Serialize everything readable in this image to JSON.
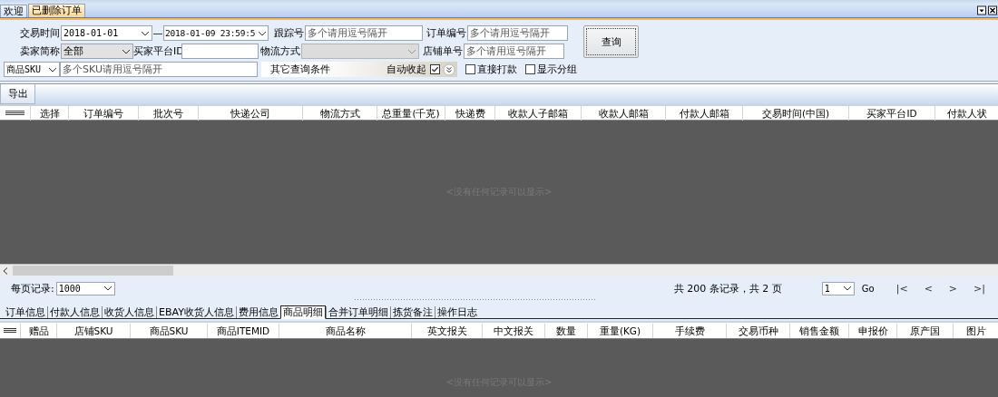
{
  "tabs": [
    {
      "label": "欢迎",
      "selected": false
    },
    {
      "label": "已删除订单",
      "selected": true
    }
  ],
  "filter": {
    "trade_time": {
      "label": "交易时间",
      "from": "2018-01-01",
      "separator": "—",
      "to": "2018-01-09 23:59:5"
    },
    "tracking_no": {
      "label": "跟踪号",
      "placeholder": "多个请用逗号隔开"
    },
    "order_no": {
      "label": "订单编号",
      "placeholder": "多个请用逗号隔开"
    },
    "seller": {
      "label": "卖家简称",
      "value": "全部"
    },
    "buyer_id": {
      "label": "买家平台ID"
    },
    "shipping_method": {
      "label": "物流方式",
      "disabled": true
    },
    "store_order_no": {
      "label": "店铺单号",
      "placeholder": "多个请用逗号隔开"
    },
    "sku": {
      "field": "商品SKU",
      "placeholder": "多个SKU请用逗号隔开"
    },
    "more": {
      "label": "其它查询条件",
      "auto_collapse": "自动收起",
      "checked": true
    },
    "options": [
      {
        "label": "直接打款",
        "checked": false
      },
      {
        "label": "显示分组",
        "checked": false
      }
    ],
    "query_button": "查询"
  },
  "toolbar": {
    "export_button": "导出"
  },
  "orders_grid": {
    "columns": [
      "选择",
      "订单编号",
      "批次号",
      "快递公司",
      "物流方式",
      "总重量(千克)",
      "快递费",
      "收款人子邮箱",
      "收款人邮箱",
      "付款人邮箱",
      "交易时间(中国)",
      "买家平台ID",
      "付款人状"
    ],
    "empty_text": "<没有任何记录可以显示>"
  },
  "pager": {
    "page_size_label": "每页记录:",
    "page_size": "1000",
    "summary": "共 200 条记录，共 2 页",
    "page": "1",
    "go": "Go",
    "nav": [
      "|<",
      "<",
      ">",
      ">|"
    ]
  },
  "detail_tabs": [
    {
      "label": "订单信息",
      "selected": false
    },
    {
      "label": "付款人信息",
      "selected": false
    },
    {
      "label": "收货人信息",
      "selected": false
    },
    {
      "label": "EBAY收货人信息",
      "selected": false
    },
    {
      "label": "费用信息",
      "selected": false
    },
    {
      "label": "商品明细",
      "selected": true
    },
    {
      "label": "合并订单明细",
      "selected": false
    },
    {
      "label": "拣货备注",
      "selected": false
    },
    {
      "label": "操作日志",
      "selected": false
    }
  ],
  "detail_grid": {
    "columns": [
      "赠品",
      "店铺SKU",
      "商品SKU",
      "商品ITEMID",
      "商品名称",
      "英文报关",
      "中文报关",
      "数量",
      "重量(KG)",
      "手续费",
      "交易币种",
      "销售金额",
      "申报价",
      "原产国",
      "图片"
    ],
    "empty_text": "<没有任何记录可以显示>"
  }
}
